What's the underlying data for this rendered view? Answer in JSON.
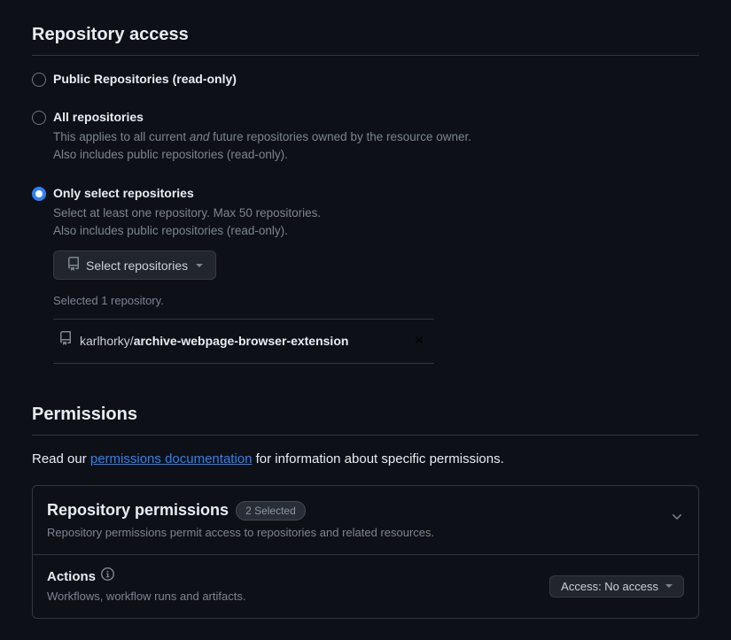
{
  "repoAccess": {
    "heading": "Repository access",
    "options": {
      "public": {
        "label": "Public Repositories (read-only)"
      },
      "all": {
        "label": "All repositories",
        "desc1_pre": "This applies to all current ",
        "desc1_em": "and",
        "desc1_post": " future repositories owned by the resource owner.",
        "desc2": "Also includes public repositories (read-only)."
      },
      "select": {
        "label": "Only select repositories",
        "desc1": "Select at least one repository. Max 50 repositories.",
        "desc2": "Also includes public repositories (read-only).",
        "buttonLabel": "Select repositories",
        "selectedCount": "Selected 1 repository.",
        "selectedRepo": {
          "owner": "karlhorky/",
          "name": "archive-webpage-browser-extension"
        }
      }
    }
  },
  "permissions": {
    "heading": "Permissions",
    "introPre": "Read our ",
    "introLink": "permissions documentation",
    "introPost": " for information about specific permissions.",
    "repoPerms": {
      "title": "Repository permissions",
      "badge": "2 Selected",
      "subtitle": "Repository permissions permit access to repositories and related resources.",
      "rows": [
        {
          "name": "Actions",
          "desc": "Workflows, workflow runs and artifacts.",
          "access": "Access: No access"
        }
      ]
    }
  }
}
